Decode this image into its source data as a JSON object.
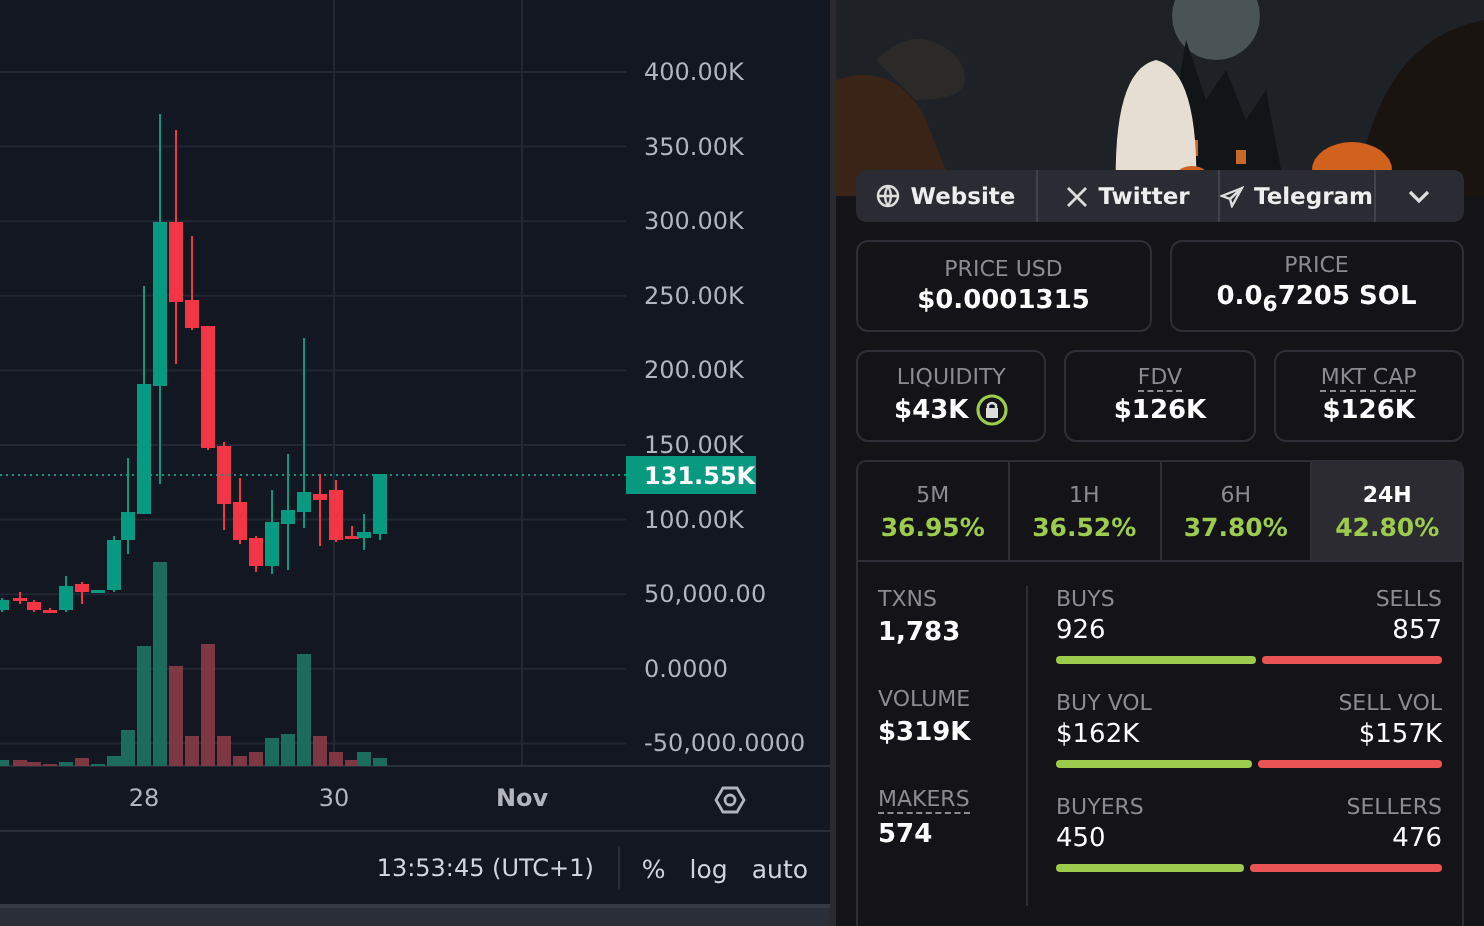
{
  "chart": {
    "price_axis": [
      "400.00K",
      "350.00K",
      "300.00K",
      "250.00K",
      "200.00K",
      "150.00K",
      "100.00K",
      "50,000.00",
      "0.0000",
      "-50,000.0000"
    ],
    "last_price": "131.55K",
    "time_axis": [
      "28",
      "30",
      "Nov"
    ],
    "clock": "13:53:45 (UTC+1)",
    "scale_buttons": [
      "%",
      "log",
      "auto"
    ]
  },
  "links": [
    {
      "label": "Website",
      "kind": "website"
    },
    {
      "label": "Twitter",
      "kind": "twitter"
    },
    {
      "label": "Telegram",
      "kind": "telegram"
    }
  ],
  "price_cards": [
    {
      "label": "PRICE USD",
      "value": "$0.0001315"
    },
    {
      "label": "PRICE",
      "value": "0.0$_{6}$7205 SOL"
    }
  ],
  "metric_cards": [
    {
      "label": "LIQUIDITY",
      "value": "$43K",
      "locked": true,
      "underlined": false
    },
    {
      "label": "FDV",
      "value": "$126K",
      "locked": false,
      "underlined": true
    },
    {
      "label": "MKT CAP",
      "value": "$126K",
      "locked": false,
      "underlined": true
    }
  ],
  "timeframes": [
    {
      "label": "5M",
      "change": "36.95%",
      "selected": false
    },
    {
      "label": "1H",
      "change": "36.52%",
      "selected": false
    },
    {
      "label": "6H",
      "change": "37.80%",
      "selected": false
    },
    {
      "label": "24H",
      "change": "42.80%",
      "selected": true
    }
  ],
  "stats": [
    {
      "label": "TXNS",
      "value": "1,783",
      "underlined": false,
      "left_label": "BUYS",
      "left_value": "926",
      "right_label": "SELLS",
      "right_value": "857",
      "level": 0.52
    },
    {
      "label": "VOLUME",
      "value": "$319K",
      "underlined": false,
      "left_label": "BUY VOL",
      "left_value": "$162K",
      "right_label": "SELL VOL",
      "right_value": "$157K",
      "level": 0.51
    },
    {
      "label": "MAKERS",
      "value": "574",
      "underlined": true,
      "left_label": "BUYERS",
      "left_value": "450",
      "right_label": "SELLERS",
      "right_value": "476",
      "level": 0.486
    }
  ]
}
